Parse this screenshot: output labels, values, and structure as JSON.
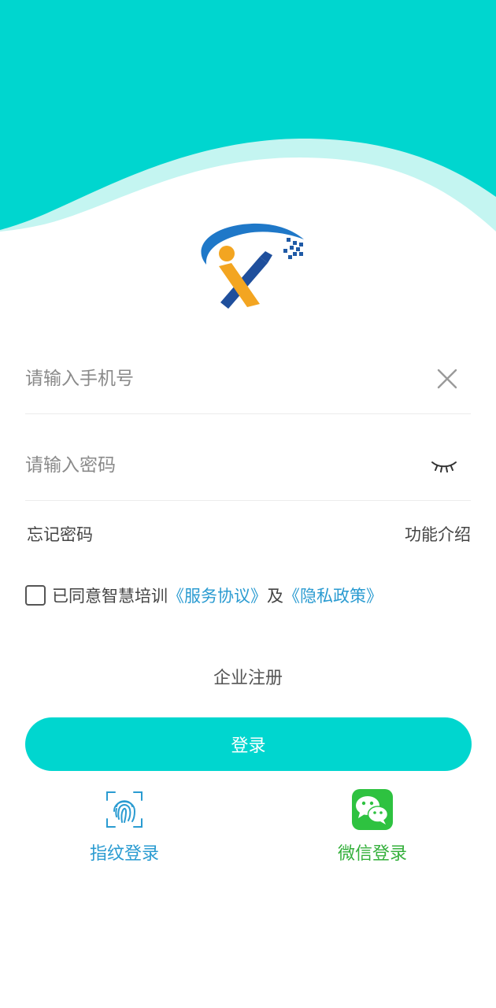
{
  "login": {
    "phone_placeholder": "请输入手机号",
    "password_placeholder": "请输入密码",
    "forgot_password": "忘记密码",
    "feature_intro": "功能介绍",
    "agree_prefix": "已同意智慧培训",
    "service_agreement": "《服务协议》",
    "agree_and": "及",
    "privacy_policy": "《隐私政策》",
    "register": "企业注册",
    "login_button": "登录",
    "fingerprint_login": "指纹登录",
    "wechat_login": "微信登录"
  },
  "colors": {
    "primary": "#00d6cf",
    "wave_light": "#c4f5f1",
    "link_blue": "#2a9bd1",
    "wechat_green": "#35b03c"
  },
  "icons": {
    "clear": "close-icon",
    "password_toggle": "eye-closed-icon",
    "fingerprint": "fingerprint-icon",
    "wechat": "wechat-icon"
  }
}
